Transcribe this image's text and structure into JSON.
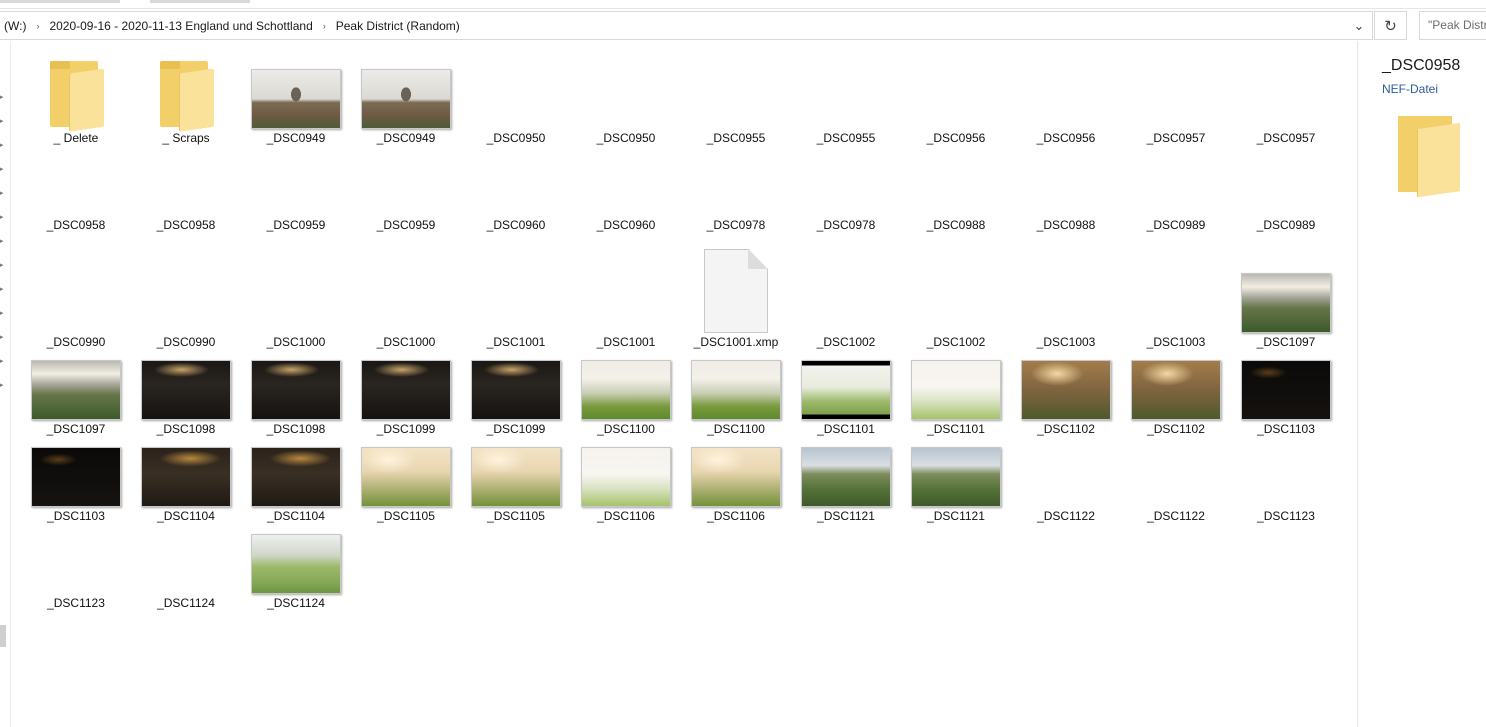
{
  "address": {
    "crumbs": [
      "(W:)",
      "2020-09-16 - 2020-11-13 England und Schottland",
      "Peak District (Random)"
    ],
    "separator": "›",
    "dropdown_glyph": "⌄",
    "refresh_glyph": "↻",
    "search_placeholder": "\"Peak District (Random)\" durchsuchen"
  },
  "preview": {
    "name": "_DSC0958",
    "type": "NEF-Datei",
    "icon": "folder-icon"
  },
  "items": [
    {
      "label": "_ Delete",
      "thumb": "folder"
    },
    {
      "label": "_ Scraps",
      "thumb": "folder"
    },
    {
      "label": "_DSC0949",
      "thumb": "tree"
    },
    {
      "label": "_DSC0949",
      "thumb": "tree"
    },
    {
      "label": "_DSC0950",
      "thumb": "none"
    },
    {
      "label": "_DSC0950",
      "thumb": "none"
    },
    {
      "label": "_DSC0955",
      "thumb": "none"
    },
    {
      "label": "_DSC0955",
      "thumb": "none"
    },
    {
      "label": "_DSC0956",
      "thumb": "none"
    },
    {
      "label": "_DSC0956",
      "thumb": "none"
    },
    {
      "label": "_DSC0957",
      "thumb": "none"
    },
    {
      "label": "_DSC0957",
      "thumb": "none"
    },
    {
      "label": "_DSC0958",
      "thumb": "none"
    },
    {
      "label": "_DSC0958",
      "thumb": "none"
    },
    {
      "label": "_DSC0959",
      "thumb": "none"
    },
    {
      "label": "_DSC0959",
      "thumb": "none"
    },
    {
      "label": "_DSC0960",
      "thumb": "none"
    },
    {
      "label": "_DSC0960",
      "thumb": "none"
    },
    {
      "label": "_DSC0978",
      "thumb": "none"
    },
    {
      "label": "_DSC0978",
      "thumb": "none"
    },
    {
      "label": "_DSC0988",
      "thumb": "none"
    },
    {
      "label": "_DSC0988",
      "thumb": "none"
    },
    {
      "label": "_DSC0989",
      "thumb": "none"
    },
    {
      "label": "_DSC0989",
      "thumb": "none"
    },
    {
      "label": "_DSC0990",
      "thumb": "none"
    },
    {
      "label": "_DSC0990",
      "thumb": "none"
    },
    {
      "label": "_DSC1000",
      "thumb": "none"
    },
    {
      "label": "_DSC1000",
      "thumb": "none"
    },
    {
      "label": "_DSC1001",
      "thumb": "none"
    },
    {
      "label": "_DSC1001",
      "thumb": "none"
    },
    {
      "label": "_DSC1001.xmp",
      "thumb": "doc"
    },
    {
      "label": "_DSC1002",
      "thumb": "none"
    },
    {
      "label": "_DSC1002",
      "thumb": "none"
    },
    {
      "label": "_DSC1003",
      "thumb": "none"
    },
    {
      "label": "_DSC1003",
      "thumb": "none"
    },
    {
      "label": "_DSC1097",
      "thumb": "val"
    },
    {
      "label": "_DSC1097",
      "thumb": "val"
    },
    {
      "label": "_DSC1098",
      "thumb": "dark"
    },
    {
      "label": "_DSC1098",
      "thumb": "dark"
    },
    {
      "label": "_DSC1099",
      "thumb": "dark"
    },
    {
      "label": "_DSC1099",
      "thumb": "dark"
    },
    {
      "label": "_DSC1100",
      "thumb": "bright"
    },
    {
      "label": "_DSC1100",
      "thumb": "bright"
    },
    {
      "label": "_DSC1101",
      "thumb": "letter"
    },
    {
      "label": "_DSC1101",
      "thumb": "vbright"
    },
    {
      "label": "_DSC1102",
      "thumb": "warm"
    },
    {
      "label": "_DSC1102",
      "thumb": "warm"
    },
    {
      "label": "_DSC1103",
      "thumb": "black"
    },
    {
      "label": "_DSC1103",
      "thumb": "black"
    },
    {
      "label": "_DSC1104",
      "thumb": "dark2"
    },
    {
      "label": "_DSC1104",
      "thumb": "dark2"
    },
    {
      "label": "_DSC1105",
      "thumb": "warmbright"
    },
    {
      "label": "_DSC1105",
      "thumb": "warmbright"
    },
    {
      "label": "_DSC1106",
      "thumb": "vbright"
    },
    {
      "label": "_DSC1106",
      "thumb": "warmbright"
    },
    {
      "label": "_DSC1121",
      "thumb": "hill"
    },
    {
      "label": "_DSC1121",
      "thumb": "hill"
    },
    {
      "label": "_DSC1122",
      "thumb": "none"
    },
    {
      "label": "_DSC1122",
      "thumb": "none"
    },
    {
      "label": "_DSC1123",
      "thumb": "none"
    },
    {
      "label": "_DSC1123",
      "thumb": "none"
    },
    {
      "label": "_DSC1124",
      "thumb": "none"
    },
    {
      "label": "_DSC1124",
      "thumb": "hill2"
    }
  ]
}
